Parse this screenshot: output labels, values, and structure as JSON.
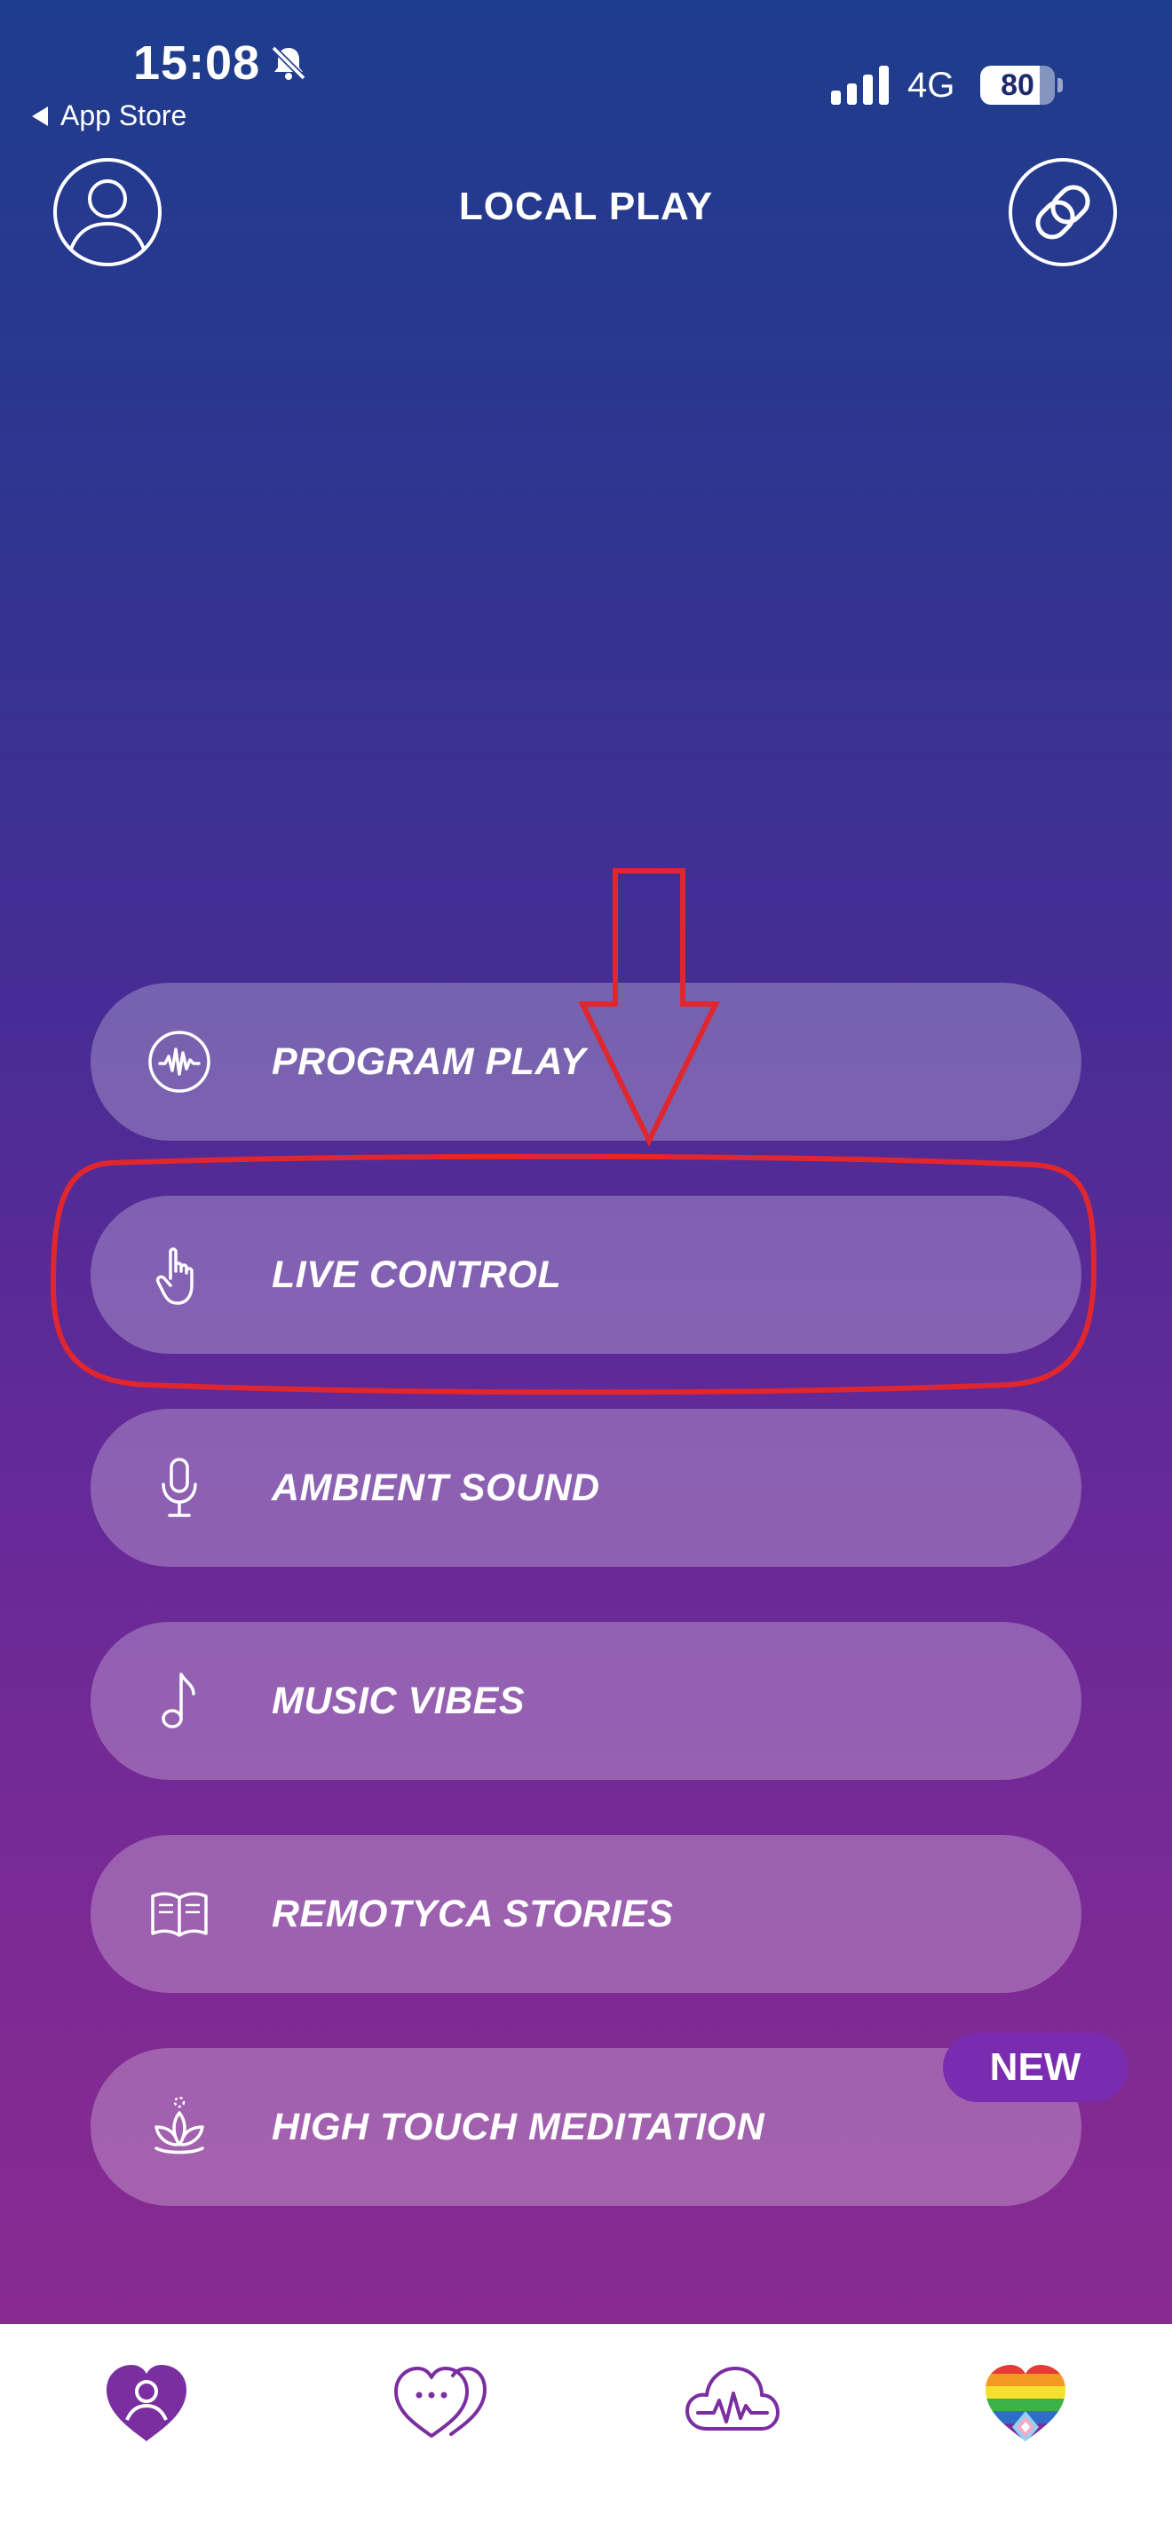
{
  "status_bar": {
    "time": "15:08",
    "back_label": "App Store",
    "network": "4G",
    "battery_percent": "80",
    "battery_level": 0.8,
    "icons": [
      "bell-slash-icon",
      "signal-icon"
    ]
  },
  "header": {
    "title": "LOCAL PLAY",
    "left_icon": "profile-icon",
    "right_icon": "link-rings-icon"
  },
  "menu": {
    "items": [
      {
        "label": "PROGRAM PLAY",
        "icon": "waveform-circle-icon"
      },
      {
        "label": "LIVE CONTROL",
        "icon": "hand-pointer-icon"
      },
      {
        "label": "AMBIENT SOUND",
        "icon": "microphone-icon"
      },
      {
        "label": "MUSIC VIBES",
        "icon": "music-note-icon"
      },
      {
        "label": "REMOTYCA STORIES",
        "icon": "open-book-icon"
      },
      {
        "label": "HIGH TOUCH MEDITATION",
        "icon": "lotus-icon",
        "badge": "NEW"
      }
    ]
  },
  "annotation": {
    "color": "#e0262e",
    "shapes": [
      "down-arrow",
      "ellipse-around-live-control"
    ]
  },
  "tabbar": {
    "tabs": [
      {
        "icon": "heart-person-icon",
        "active": true
      },
      {
        "icon": "heart-chat-icon",
        "active": false
      },
      {
        "icon": "cloud-wave-icon",
        "active": false
      },
      {
        "icon": "rainbow-heart-icon",
        "active": false
      }
    ],
    "accent": "#7a2ea0"
  },
  "colors": {
    "gradient_top": "#1e3d8c",
    "gradient_bottom": "#8f2b8e",
    "button_fill": "rgba(255,255,255,0.26)",
    "badge": "#7a2cb0"
  }
}
